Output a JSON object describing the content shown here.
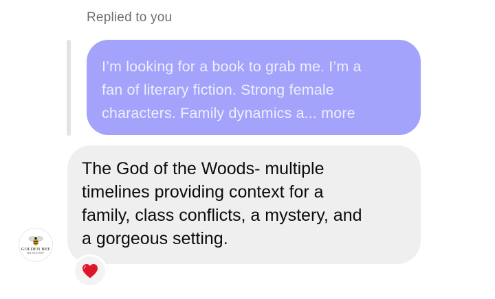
{
  "reply_context": {
    "label": "Replied to you",
    "quoted_lines": [
      "I’m looking for a book to grab me. I’m a",
      "fan of literary fiction. Strong female",
      "characters. Family dynamics a..."
    ],
    "more_label": " more"
  },
  "message": {
    "lines": [
      "The God of the Woods- multiple",
      "timelines providing context for a",
      "family, class conflicts, a mystery, and",
      "a gorgeous setting."
    ]
  },
  "sender_avatar": {
    "brand": "GOLDEN BEE",
    "sub": "BOOKSHOP",
    "icon": "bee-icon"
  },
  "reaction": {
    "icon": "red-heart-icon",
    "color": "#e0142b"
  },
  "colors": {
    "quoted_bubble": "#a3a3fb",
    "reply_bubble": "#efefef"
  }
}
